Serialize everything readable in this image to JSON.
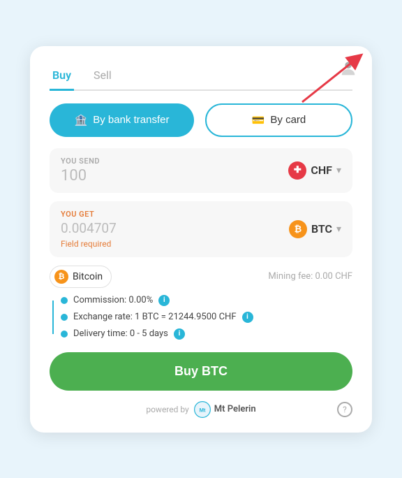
{
  "tabs": {
    "buy": "Buy",
    "sell": "Sell"
  },
  "payment": {
    "bank_label": "By bank transfer",
    "card_label": "By card"
  },
  "send": {
    "label": "YOU SEND",
    "value": "100",
    "currency": "CHF",
    "currency_symbol": "+"
  },
  "get": {
    "label": "YOU GET",
    "value": "0.004707",
    "currency": "BTC",
    "error": "Field required"
  },
  "bitcoin_row": {
    "coin_label": "Bitcoin",
    "mining_fee_label": "Mining fee: 0.00 CHF"
  },
  "info": {
    "commission": "Commission: 0.00%",
    "exchange_rate": "Exchange rate: 1 BTC = 21244.9500 CHF",
    "delivery": "Delivery time: 0 - 5 days"
  },
  "buy_button": "Buy BTC",
  "footer": {
    "powered_by": "powered by",
    "brand": "Mt\nPelerin"
  },
  "help": "?",
  "profile_title": "Profile"
}
